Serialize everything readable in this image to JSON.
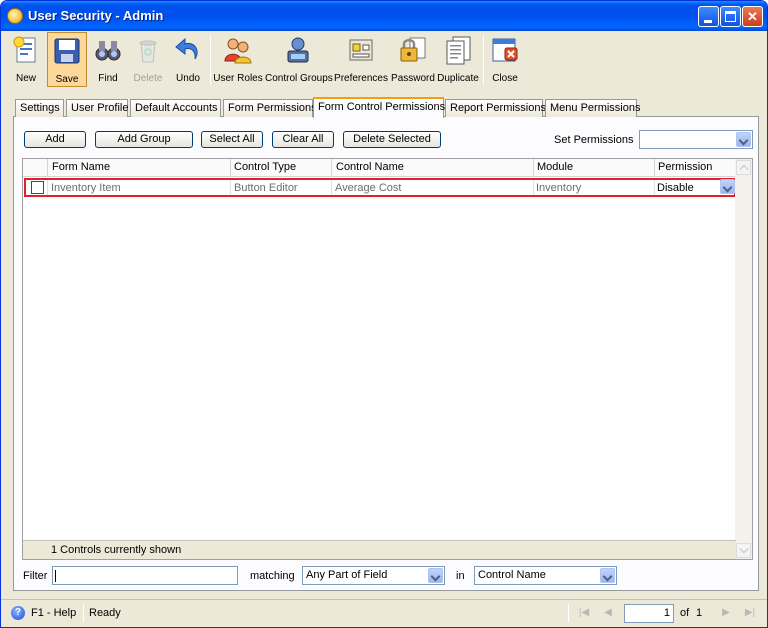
{
  "window": {
    "title": "User Security - Admin"
  },
  "toolbar": {
    "new": "New",
    "save": "Save",
    "find": "Find",
    "delete": "Delete",
    "undo": "Undo",
    "user_roles": "User Roles",
    "control_groups": "Control Groups",
    "preferences": "Preferences",
    "password": "Password",
    "duplicate": "Duplicate",
    "close": "Close"
  },
  "tabs": {
    "settings": "Settings",
    "user_profile": "User Profile",
    "default_accounts": "Default Accounts",
    "form_permissions": "Form Permissions",
    "form_control_permissions": "Form Control Permissions",
    "report_permissions": "Report Permissions",
    "menu_permissions": "Menu Permissions",
    "active": "Form Control Permissions"
  },
  "actions": {
    "add": "Add",
    "add_group": "Add Group",
    "select_all": "Select All",
    "clear_all": "Clear All",
    "delete_selected": "Delete Selected",
    "set_permissions_label": "Set Permissions",
    "set_permissions_value": ""
  },
  "grid": {
    "columns": {
      "form_name": "Form Name",
      "control_type": "Control Type",
      "control_name": "Control Name",
      "module": "Module",
      "permission": "Permission"
    },
    "rows": [
      {
        "form_name": "Inventory Item",
        "control_type": "Button Editor",
        "control_name": "Average Cost",
        "module": "Inventory",
        "permission": "Disable",
        "checked": false
      }
    ],
    "footer": "1 Controls currently shown"
  },
  "filter": {
    "label": "Filter",
    "value": "",
    "matching_label": "matching",
    "matching_value": "Any Part of Field",
    "in_label": "in",
    "in_value": "Control Name"
  },
  "status": {
    "help": "F1 - Help",
    "state": "Ready",
    "page": "1",
    "of_label": "of",
    "total_pages": "1"
  },
  "colors": {
    "title_bar": "#0053ee",
    "selected_row_border": "#e0202a",
    "active_tab_accent": "#f4a00a"
  }
}
